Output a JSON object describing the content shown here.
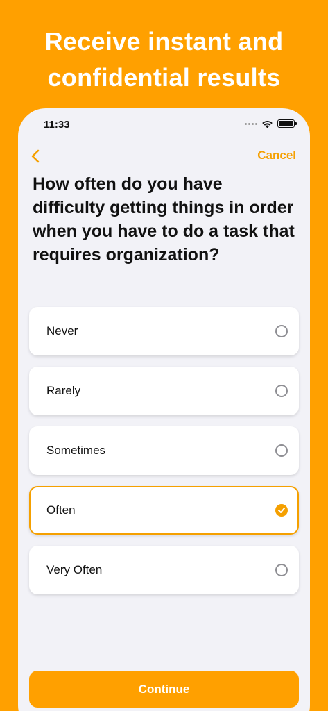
{
  "headline": {
    "line1": "Receive instant and",
    "line2": "confidential results"
  },
  "status_bar": {
    "time": "11:33"
  },
  "nav": {
    "cancel_label": "Cancel"
  },
  "question": "How often do you have difficulty getting things in order when you have to do a task that requires organization?",
  "options": [
    {
      "label": "Never",
      "selected": false
    },
    {
      "label": "Rarely",
      "selected": false
    },
    {
      "label": "Sometimes",
      "selected": false
    },
    {
      "label": "Often",
      "selected": true
    },
    {
      "label": "Very Often",
      "selected": false
    }
  ],
  "continue_label": "Continue",
  "colors": {
    "background": "#FFA000",
    "accent": "#F5A000",
    "card": "#FFFFFF",
    "screen": "#F2F2F7"
  },
  "icons": {
    "back": "chevron-left-icon",
    "wifi": "wifi-icon",
    "battery": "battery-icon",
    "signal": "signal-dots-icon",
    "radio_checked": "checkmark-circle-icon"
  }
}
